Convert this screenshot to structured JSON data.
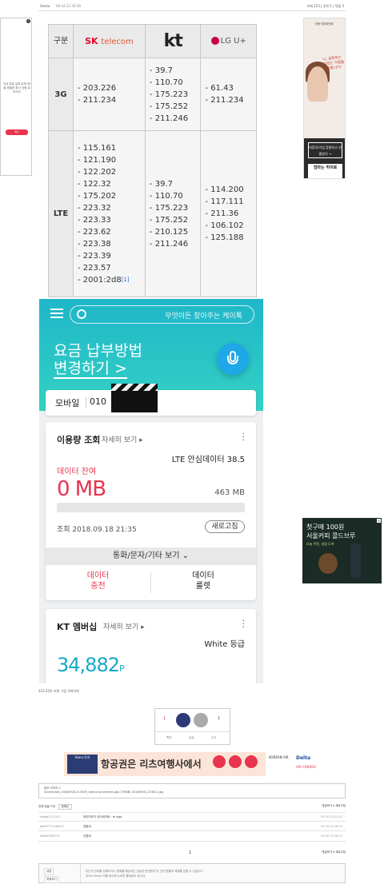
{
  "post": {
    "nick": "Siesta",
    "date": "09-18 21:36:58",
    "views": "조회 153",
    "recommend": "추천 1",
    "comments": "댓글 3"
  },
  "left_ad": {
    "text": "국내 유일 실제 로또1등을 배출한 회사 당첨 로또리치",
    "button": "확인"
  },
  "right_ad": {
    "header": "대한이혼회연회",
    "msg": "나, 김원희는 피로는 가렵을 응원합니다!",
    "btn1": "미혼모/기업 응원하고 선물받기 →",
    "btn2": "엄마는 히어로"
  },
  "carrier_table": {
    "header_label": "구분",
    "carriers": [
      "SK telecom",
      "kt",
      "LG U+"
    ],
    "rows": [
      {
        "label": "3G",
        "sk": [
          "- 203.226",
          "- 211.234"
        ],
        "kt": [
          "- 39.7",
          "- 110.70",
          "- 175.223",
          "- 175.252",
          "- 211.246"
        ],
        "lg": [
          "- 61.43",
          "- 211.234"
        ]
      },
      {
        "label": "LTE",
        "sk": [
          "- 115.161",
          "- 121.190",
          "- 122.202",
          "- 122.32",
          "- 175.202",
          "- 223.32",
          "- 223.33",
          "- 223.62",
          "- 223.38",
          "- 223.39",
          "- 223.57",
          "- 2001:2d8"
        ],
        "kt": [
          "- 39.7",
          "- 110.70",
          "- 175.223",
          "- 175.252",
          "- 210.125",
          "- 211.246"
        ],
        "lg": [
          "- 114.200",
          "- 117.111",
          "- 211.36",
          "- 106.102",
          "- 125.188"
        ]
      }
    ],
    "footnote": "[1]"
  },
  "app": {
    "search_placeholder": "무엇이든 찾아주는 케이톡",
    "headline1": "요금 납부방법",
    "headline2": "변경하기 >",
    "mobile_label": "모바일",
    "mobile_number": "010",
    "usage": {
      "title": "이용량 조회",
      "detail": "자세히 보기 ▸",
      "plan": "LTE 안심데이터 38.5",
      "remaining_label": "데이터 잔여",
      "remaining": "0 MB",
      "total": "463 MB",
      "used_fraction": 0.0,
      "query": "조회  2018.09.18  21:35",
      "refresh": "새로고침",
      "more": "통화/문자/기타 보기 ⌄",
      "btn_left": "데이터\n충전",
      "btn_right": "데이터\n룰렛"
    },
    "membership": {
      "title": "KT 멤버십",
      "detail": "자세히 보기 ▸",
      "grade": "White 등급",
      "points": "34,882",
      "unit": "P"
    }
  },
  "right_ad2": {
    "t1": "첫구매 100원\n서울커피 콜드브루",
    "t2": "오늘 주문, 내일 도착"
  },
  "caption": "223.33은 또한 그림 가져가자",
  "vote": {
    "up": "1",
    "down": "1",
    "l1": "쪽지",
    "l2": "공유",
    "l3": "신고"
  },
  "banner": {
    "logo": "Hana 투어",
    "text": "항공권은 리츠여행사에서",
    "airlines1": "KOREAN AIR",
    "airlines2": "Delta",
    "airlines3": "AIR CANADA"
  },
  "attachments": {
    "title": "첨부 이미지 2",
    "files": "Screenshot_20180918-213409_Samsung Internet.jpg  (739KB)  20180918_213612.jpg"
  },
  "comments": {
    "header": "전체 댓글 3개",
    "sort": "등록순",
    "right": "댓글보기 ▾   새로고침",
    "rows": [
      {
        "user": "siesta5711111",
        "msg": "데이터보고 공식네이버 : m Aga",
        "date": "09-18 22:01:01"
      },
      {
        "user": "ddat77711a8471",
        "msg": "괜찮네",
        "date": "09-18 22:06:19"
      },
      {
        "user": "hkd82236771",
        "msg": "관찮네",
        "date": "09-18 22:06:13"
      }
    ],
    "page": "1",
    "page_right": "댓글보기 ▾   새로고침"
  },
  "footer": {
    "b1": "새창",
    "b2": "목록보기",
    "text": "타인의 권리를 침해하거나 명예를 훼손하는 댓글은 운영원칙 및 관련 법률에 제재를 받을 수 있습니다.\nShift+Enter 키를 동시에 누르면 줄바꿈이 됩니다."
  }
}
